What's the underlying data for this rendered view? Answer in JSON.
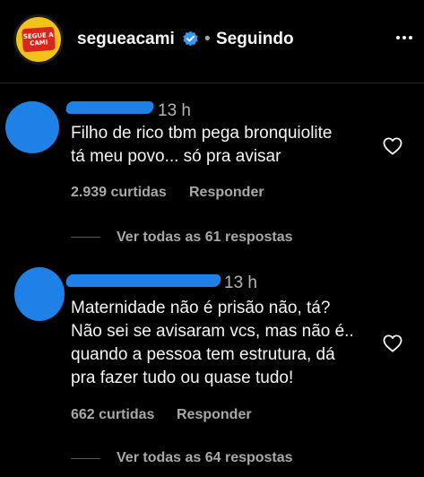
{
  "header": {
    "avatar_text": "SEGUE A CAMI",
    "username": "segueacami",
    "separator": "•",
    "follow_status": "Seguindo"
  },
  "comments": [
    {
      "time": "13 h",
      "text_line1": "Filho de rico tbm pega bronquiolite",
      "text_line2": "tá meu povo... só pra avisar",
      "likes": "2.939 curtidas",
      "reply_label": "Responder",
      "view_replies": "Ver todas as 61 respostas"
    },
    {
      "time": "13 h",
      "text_line1": "Maternidade não é prisão não, tá?",
      "text_line2": "Não sei se avisaram vcs, mas não é..",
      "text_line3": "quando a pessoa tem estrutura, dá",
      "text_line4": "pra fazer tudo ou quase tudo!",
      "likes": "662 curtidas",
      "reply_label": "Responder",
      "view_replies": "Ver todas as 64 respostas"
    }
  ],
  "colors": {
    "background": "#000000",
    "text": "#f5f5f5",
    "muted": "#a8a8a8",
    "blur_redaction": "#1f80e6",
    "verified": "#3897f0",
    "avatar_bg": "#f2c21b",
    "avatar_badge": "#d9261c"
  },
  "icons": [
    "verified-badge-icon",
    "more-options-icon",
    "heart-icon"
  ]
}
